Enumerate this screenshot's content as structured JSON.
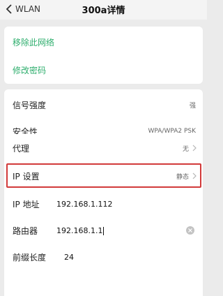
{
  "header": {
    "back_label": "WLAN",
    "title": "300a详情"
  },
  "actions": {
    "forget": "移除此网络",
    "change_password": "修改密码"
  },
  "info": {
    "signal_label": "信号强度",
    "signal_value": "强",
    "security_label": "安全性",
    "security_value": "WPA/WPA2 PSK"
  },
  "settings": {
    "proxy_label": "代理",
    "proxy_value": "无",
    "ip_settings_label": "IP 设置",
    "ip_settings_value": "静态",
    "ip_address_label": "IP 地址",
    "ip_address_value": "192.168.1.112",
    "router_label": "路由器",
    "router_value": "192.168.1.1",
    "prefix_label": "前缀长度",
    "prefix_value": "24"
  },
  "colors": {
    "accent": "#2eae6d",
    "highlight_border": "#d23a3a"
  }
}
